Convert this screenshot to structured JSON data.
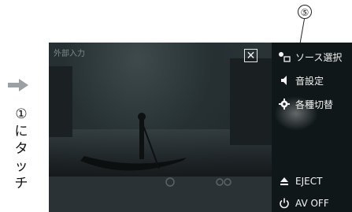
{
  "callout_number": "⑤",
  "instruction": {
    "step_number": "①",
    "chars": [
      "に",
      "タ",
      "ッ",
      "チ"
    ]
  },
  "screen": {
    "source_label": "外部入力",
    "close_label": "✕",
    "menu": [
      {
        "label": "ソース選択",
        "icon": "source-select-icon"
      },
      {
        "label": "音設定",
        "icon": "speaker-icon"
      },
      {
        "label": "各種切替",
        "icon": "gear-icon"
      },
      {
        "label": "EJECT",
        "icon": "eject-icon"
      },
      {
        "label": "AV OFF",
        "icon": "power-icon"
      }
    ]
  },
  "colors": {
    "arrow": "#9aa0a3",
    "menu_bg": "#101719",
    "menu_text": "#f4f4f4"
  }
}
